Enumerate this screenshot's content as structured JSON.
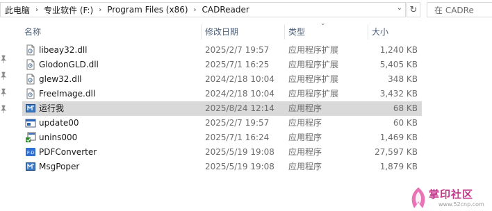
{
  "breadcrumb": {
    "items": [
      "此电脑",
      "专业软件 (F:)",
      "Program Files (x86)",
      "CADReader"
    ],
    "separator": "›"
  },
  "search": {
    "placeholder": "在 CADRe"
  },
  "columns": {
    "name": "名称",
    "date": "修改日期",
    "type": "类型",
    "size": "大小"
  },
  "files": [
    {
      "name": "libeay32.dll",
      "date": "2025/2/7 19:57",
      "type": "应用程序扩展",
      "size": "1,240 KB",
      "icon": "dll-file-icon"
    },
    {
      "name": "GlodonGLD.dll",
      "date": "2025/7/1 16:25",
      "type": "应用程序扩展",
      "size": "5,405 KB",
      "icon": "dll-file-icon"
    },
    {
      "name": "glew32.dll",
      "date": "2024/2/18 10:04",
      "type": "应用程序扩展",
      "size": "348 KB",
      "icon": "dll-file-icon"
    },
    {
      "name": "FreeImage.dll",
      "date": "2024/2/18 10:04",
      "type": "应用程序扩展",
      "size": "3,432 KB",
      "icon": "dll-file-icon"
    },
    {
      "name": "运行我",
      "date": "2025/8/24 12:14",
      "type": "应用程序",
      "size": "68 KB",
      "icon": "cad-app-icon",
      "selected": true
    },
    {
      "name": "update00",
      "date": "2025/2/7 19:57",
      "type": "应用程序",
      "size": "60 KB",
      "icon": "window-app-icon"
    },
    {
      "name": "unins000",
      "date": "2025/7/1 16:24",
      "type": "应用程序",
      "size": "1,469 KB",
      "icon": "installer-icon"
    },
    {
      "name": "PDFConverter",
      "date": "2025/5/19 19:08",
      "type": "应用程序",
      "size": "27,597 KB",
      "icon": "pdf-converter-icon"
    },
    {
      "name": "MsgPoper",
      "date": "2025/5/19 19:08",
      "type": "应用程序",
      "size": "1,879 KB",
      "icon": "cad-app-icon"
    }
  ],
  "watermark": {
    "text": "掌印社区",
    "url": "www.52cnp.com"
  }
}
